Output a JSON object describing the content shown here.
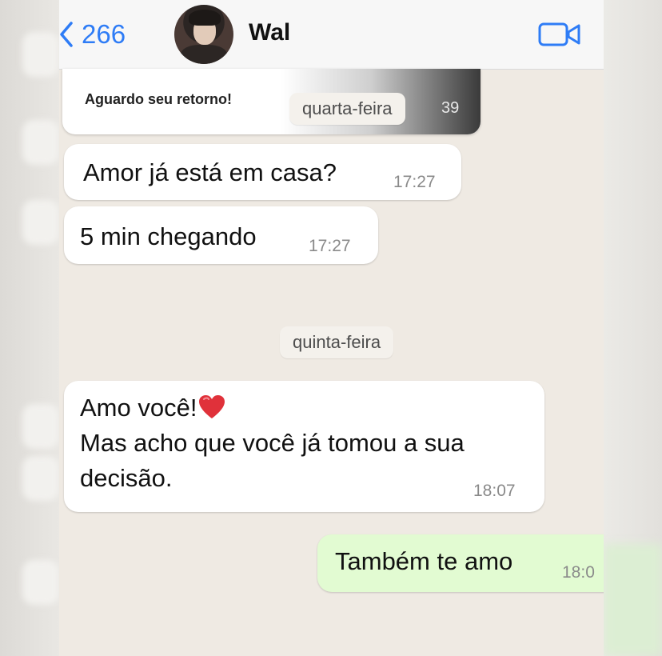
{
  "header": {
    "back_count": "266",
    "contact_name": "Wal"
  },
  "quoted_message": {
    "text": "Aguardo seu retorno!",
    "time_fragment": "39"
  },
  "date_separators": [
    "quarta-feira",
    "quinta-feira"
  ],
  "messages": [
    {
      "direction": "in",
      "text": "Amor já está em casa?",
      "time": "17:27"
    },
    {
      "direction": "in",
      "text": "5 min chegando",
      "time": "17:27"
    },
    {
      "direction": "in",
      "lines": [
        "Amo você!",
        "Mas acho que você já tomou a sua",
        "decisão."
      ],
      "emoji": "red-heart",
      "time": "18:07"
    },
    {
      "direction": "out",
      "text": "Também te amo",
      "time": "18:0"
    }
  ],
  "colors": {
    "accent": "#2e7cf6",
    "incoming_bubble": "#ffffff",
    "outgoing_bubble": "#e2fbd2",
    "chat_background": "#efeae3",
    "heart": "#e0313a"
  },
  "icons": [
    "chevron-left-icon",
    "video-call-icon",
    "heart-icon"
  ]
}
